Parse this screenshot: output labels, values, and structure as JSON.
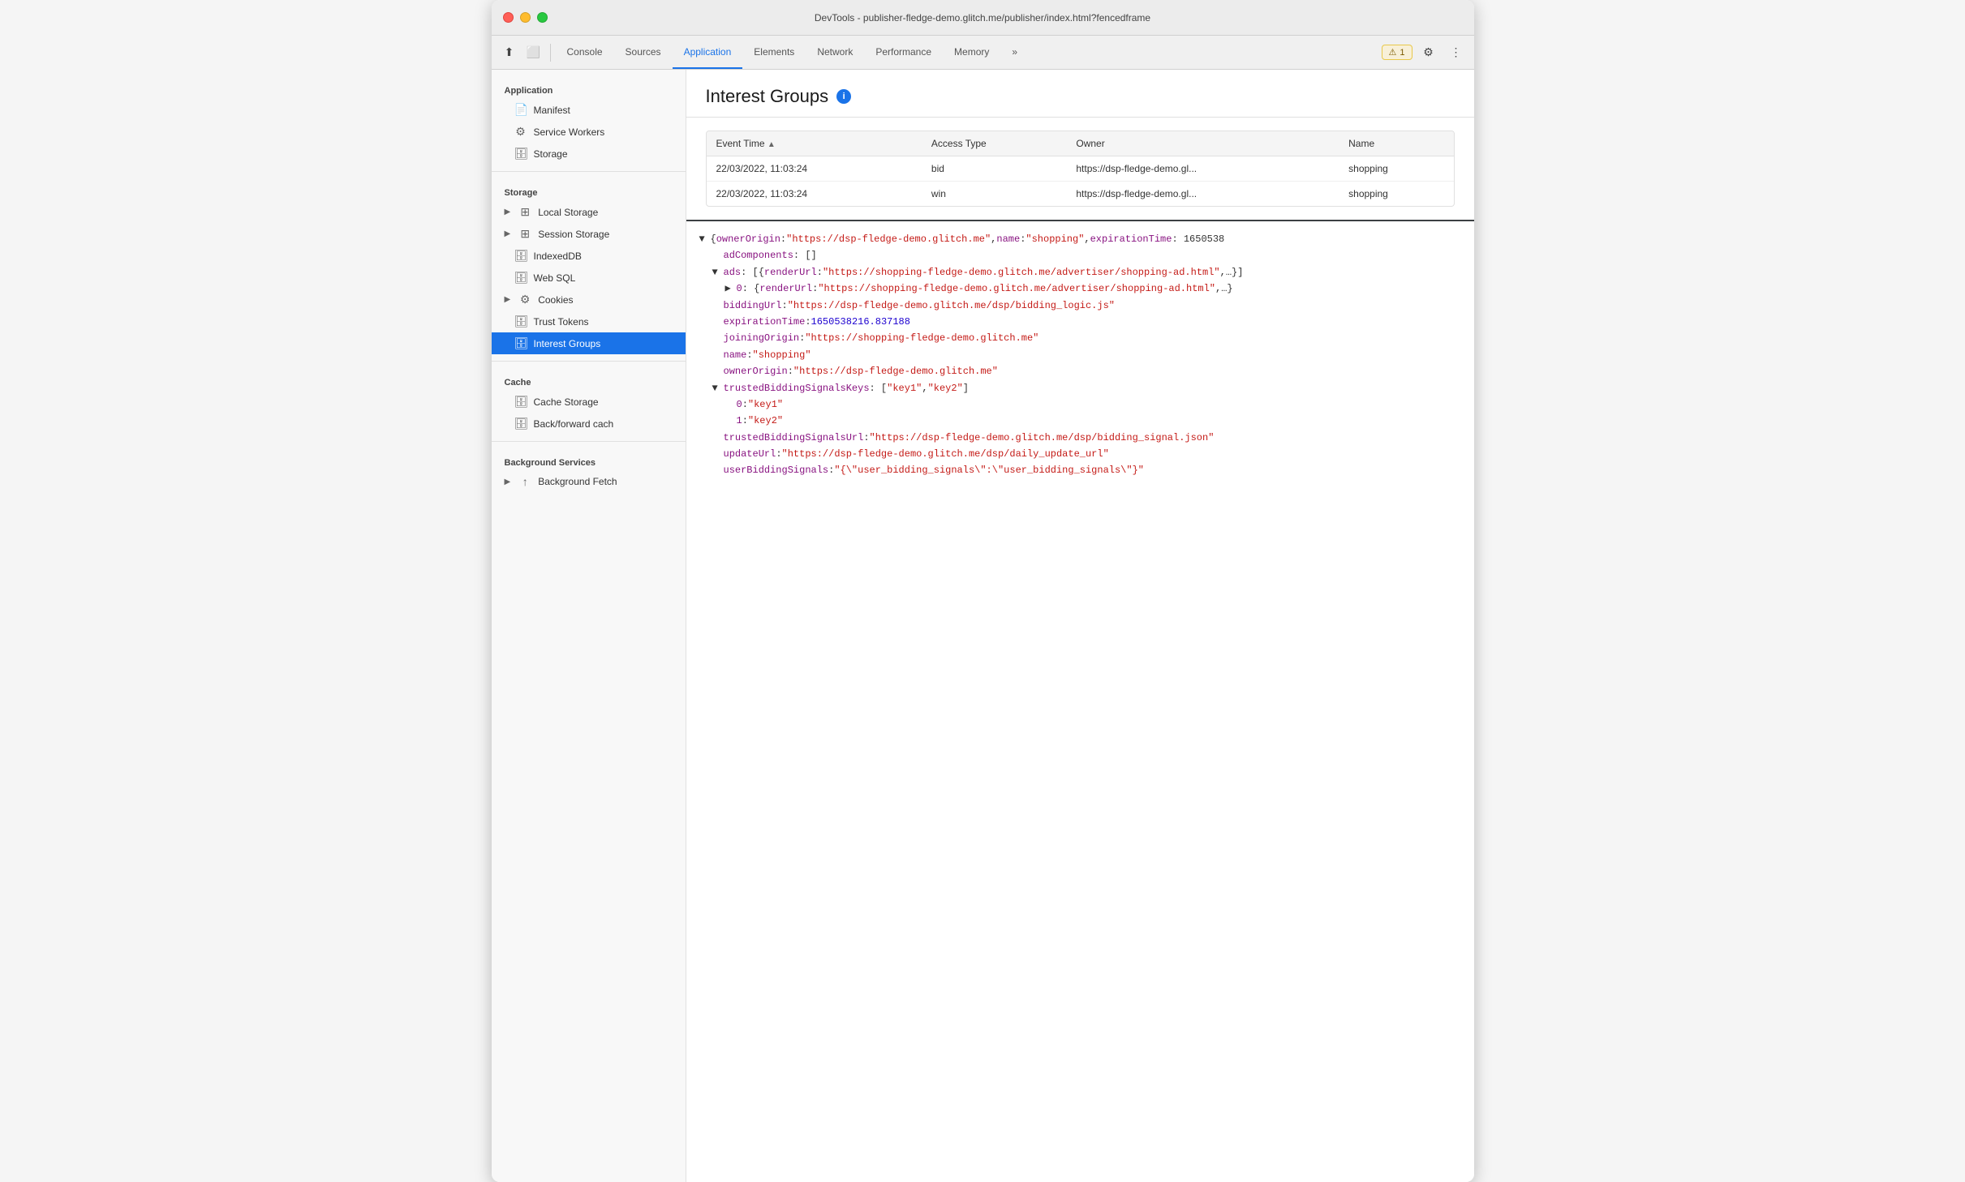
{
  "window": {
    "title": "DevTools - publisher-fledge-demo.glitch.me/publisher/index.html?fencedframe"
  },
  "toolbar": {
    "tabs": [
      {
        "id": "console",
        "label": "Console",
        "active": false
      },
      {
        "id": "sources",
        "label": "Sources",
        "active": false
      },
      {
        "id": "application",
        "label": "Application",
        "active": true
      },
      {
        "id": "elements",
        "label": "Elements",
        "active": false
      },
      {
        "id": "network",
        "label": "Network",
        "active": false
      },
      {
        "id": "performance",
        "label": "Performance",
        "active": false
      },
      {
        "id": "memory",
        "label": "Memory",
        "active": false
      }
    ],
    "more_label": "»",
    "warning_count": "1",
    "settings_label": "⚙",
    "more_options_label": "⋮"
  },
  "sidebar": {
    "sections": [
      {
        "id": "application",
        "header": "Application",
        "items": [
          {
            "id": "manifest",
            "label": "Manifest",
            "icon": "📄",
            "active": false,
            "indent": true
          },
          {
            "id": "service-workers",
            "label": "Service Workers",
            "icon": "⚙",
            "active": false,
            "indent": true
          },
          {
            "id": "storage",
            "label": "Storage",
            "icon": "🗄",
            "active": false,
            "indent": true
          }
        ]
      },
      {
        "id": "storage",
        "header": "Storage",
        "items": [
          {
            "id": "local-storage",
            "label": "Local Storage",
            "icon": "▶",
            "active": false,
            "arrow": true
          },
          {
            "id": "session-storage",
            "label": "Session Storage",
            "icon": "▶",
            "active": false,
            "arrow": true
          },
          {
            "id": "indexeddb",
            "label": "IndexedDB",
            "icon": "🗄",
            "active": false,
            "indent": true
          },
          {
            "id": "web-sql",
            "label": "Web SQL",
            "icon": "🗄",
            "active": false,
            "indent": true
          },
          {
            "id": "cookies",
            "label": "Cookies",
            "icon": "▶",
            "active": false,
            "arrow": true
          },
          {
            "id": "trust-tokens",
            "label": "Trust Tokens",
            "icon": "🗄",
            "active": false,
            "indent": true
          },
          {
            "id": "interest-groups",
            "label": "Interest Groups",
            "icon": "🗄",
            "active": true,
            "indent": true
          }
        ]
      },
      {
        "id": "cache",
        "header": "Cache",
        "items": [
          {
            "id": "cache-storage",
            "label": "Cache Storage",
            "icon": "🗄",
            "active": false,
            "indent": true
          },
          {
            "id": "backforward-cache",
            "label": "Back/forward cach",
            "icon": "🗄",
            "active": false,
            "indent": true
          }
        ]
      },
      {
        "id": "background-services",
        "header": "Background Services",
        "items": [
          {
            "id": "background-fetch",
            "label": "Background Fetch",
            "icon": "▶",
            "active": false,
            "arrow": true
          }
        ]
      }
    ]
  },
  "content": {
    "title": "Interest Groups",
    "table": {
      "columns": [
        "Event Time",
        "Access Type",
        "Owner",
        "Name"
      ],
      "rows": [
        {
          "event_time": "22/03/2022, 11:03:24",
          "access_type": "bid",
          "owner": "https://dsp-fledge-demo.gl...",
          "name": "shopping"
        },
        {
          "event_time": "22/03/2022, 11:03:24",
          "access_type": "win",
          "owner": "https://dsp-fledge-demo.gl...",
          "name": "shopping"
        }
      ]
    },
    "detail": {
      "lines": [
        {
          "indent": 0,
          "arrow": "▼",
          "key": "",
          "content_type": "plain",
          "content": "{ownerOrigin: \"https://dsp-fledge-demo.glitch.me\", name: \"shopping\", expirationTime: 1650538"
        },
        {
          "indent": 1,
          "arrow": "",
          "key": "adComponents",
          "content_type": "plain",
          "content": ": []"
        },
        {
          "indent": 1,
          "arrow": "▼",
          "key": "ads",
          "content_type": "plain",
          "content": ": [{renderUrl: \"https://shopping-fledge-demo.glitch.me/advertiser/shopping-ad.html\",…}]"
        },
        {
          "indent": 2,
          "arrow": "▶",
          "key": "0",
          "content_type": "plain",
          "content": ": {renderUrl: \"https://shopping-fledge-demo.glitch.me/advertiser/shopping-ad.html\",…}"
        },
        {
          "indent": 1,
          "arrow": "",
          "key": "biddingUrl",
          "content_type": "string",
          "content": ": \"https://dsp-fledge-demo.glitch.me/dsp/bidding_logic.js\""
        },
        {
          "indent": 1,
          "arrow": "",
          "key": "expirationTime",
          "content_type": "number",
          "content": ": 1650538216.837188"
        },
        {
          "indent": 1,
          "arrow": "",
          "key": "joiningOrigin",
          "content_type": "string",
          "content": ": \"https://shopping-fledge-demo.glitch.me\""
        },
        {
          "indent": 1,
          "arrow": "",
          "key": "name",
          "content_type": "string",
          "content": ": \"shopping\""
        },
        {
          "indent": 1,
          "arrow": "",
          "key": "ownerOrigin",
          "content_type": "string",
          "content": ": \"https://dsp-fledge-demo.glitch.me\""
        },
        {
          "indent": 1,
          "arrow": "▼",
          "key": "trustedBiddingSignalsKeys",
          "content_type": "plain",
          "content": ": [\"key1\", \"key2\"]"
        },
        {
          "indent": 2,
          "arrow": "",
          "key": "0",
          "content_type": "string",
          "content": ": \"key1\""
        },
        {
          "indent": 2,
          "arrow": "",
          "key": "1",
          "content_type": "string",
          "content": ": \"key2\""
        },
        {
          "indent": 1,
          "arrow": "",
          "key": "trustedBiddingSignalsUrl",
          "content_type": "string",
          "content": ": \"https://dsp-fledge-demo.glitch.me/dsp/bidding_signal.json\""
        },
        {
          "indent": 1,
          "arrow": "",
          "key": "updateUrl",
          "content_type": "string",
          "content": ": \"https://dsp-fledge-demo.glitch.me/dsp/daily_update_url\""
        },
        {
          "indent": 1,
          "arrow": "",
          "key": "userBiddingSignals",
          "content_type": "string",
          "content": ": \"{\\\"user_bidding_signals\\\":\\\"user_bidding_signals\\\"}\""
        }
      ]
    }
  }
}
